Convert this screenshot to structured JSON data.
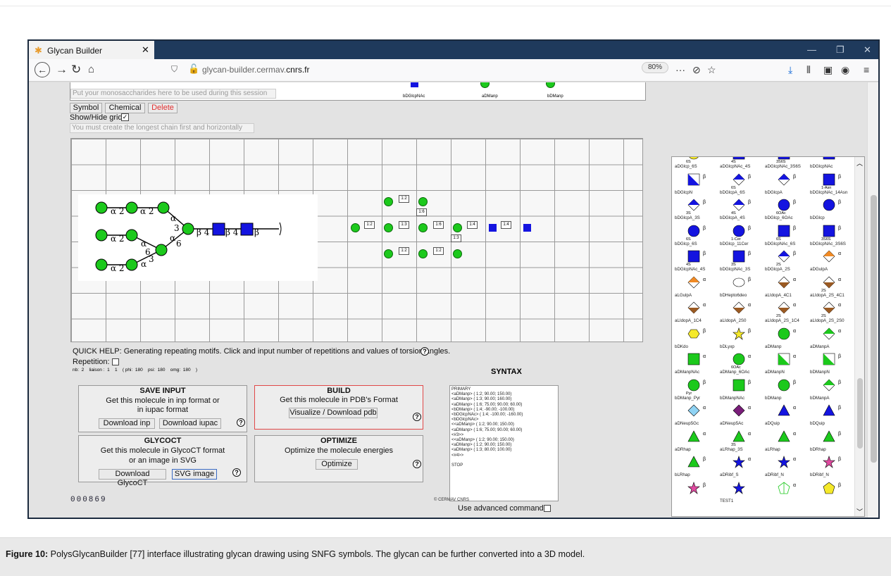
{
  "browser": {
    "tab_title": "Glycan Builder",
    "url_prefix": "glycan-builder.cermav.",
    "url_domain": "cnrs.fr",
    "zoom": "80%"
  },
  "session": {
    "placeholder": "Put your monosaccharides here to be used during this session",
    "items": [
      "bDGlcpNAc",
      "aDManp",
      "bDManp"
    ]
  },
  "toolbar": {
    "symbol": "Symbol",
    "chemical": "Chemical",
    "delete": "Delete",
    "grid_toggle": "Show/Hide grid",
    "chain_hint": "You must create the longest chain first and horizontally"
  },
  "canvas": {
    "link_labels": [
      "1:2",
      "1:6",
      "1:2",
      "1:3",
      "1:6",
      "1:4",
      "1:3",
      "1:4",
      "1:2",
      "1:2"
    ]
  },
  "quick_help": {
    "text": "QUICK HELP: Generating repeating motifs. Click and input number of repetitions and values of torsion angles.",
    "repetition": "Repetition:",
    "params": "nb:  2    liaison :  1    1    ( phi:  180    psi:  180    omg:  180    )"
  },
  "panels": {
    "save": {
      "title": "SAVE INPUT",
      "line1": "Get this molecule in inp format or",
      "line2": "in iupac format",
      "btn1": "Download inp",
      "btn2": "Download iupac"
    },
    "build": {
      "title": "BUILD",
      "line1": "Get this molecule in PDB's Format",
      "btn": "Visualize / Download pdb"
    },
    "glycoct": {
      "title": "GLYCOCT",
      "line1": "Get this molecule in GlycoCT format",
      "line2": "or an image in SVG",
      "btn1": "Download GlycoCT",
      "btn2": "SVG image"
    },
    "optimize": {
      "title": "OPTIMIZE",
      "line1": "Optimize the molecule energies",
      "btn": "Optimize"
    }
  },
  "syntax": {
    "title": "SYNTAX",
    "lines": [
      "PRIMARY",
      "<aDManp> ( 1:2; 90.00; 150.00)",
      "<aDManp> ( 1:3; 90.00; 160.00)",
      "<aDManp> ( 1:6; 75.00; 90.00; 60.00)",
      "<bDManp> ( 1:4; -90.00; -100.00)",
      "<bDGlcpNAc> ( 1:4; -100.00; -160.00)",
      "<bDGlcpNAc>",
      "<<aDManp> ( 1:2; 90.00; 150.00)",
      "<aDManp> ( 1:6; 75.00; 90.00; 60.00)",
      "<#3>>",
      "<<aDManp> ( 1:2; 90.00; 150.00)",
      "<aDManp> ( 1:2; 90.00; 150.00)",
      "<aDManp> ( 1:3; 80.00; 100.00)",
      "<#4>>",
      "",
      "STOP"
    ],
    "advanced": "Use advanced commands"
  },
  "footer": {
    "counter": "000869",
    "copyright": "© CERMAV CNRS"
  },
  "palette": [
    {
      "name": "aDGlcp_6S",
      "shape": "circle",
      "color": "#f5e92a",
      "anom": "",
      "sub": "6S"
    },
    {
      "name": "aDGlcpNAc_4S",
      "shape": "square",
      "color": "#1414e0",
      "anom": "",
      "sub": "4S"
    },
    {
      "name": "aDGlcpNAc_3S6S",
      "shape": "square",
      "color": "#1414e0",
      "anom": "",
      "sub": "3S6S"
    },
    {
      "name": "bDGlcpNAc",
      "shape": "square",
      "color": "#1414e0",
      "anom": "",
      "sub": ""
    },
    {
      "name": "bDGlcpN",
      "shape": "cross-sq",
      "color": "#1414e0",
      "anom": "β",
      "sub": ""
    },
    {
      "name": "bDGlcpA_6S",
      "shape": "diamond-top",
      "color": "#1414e0",
      "anom": "β",
      "sub": "6S"
    },
    {
      "name": "bDGlcpA",
      "shape": "diamond-top",
      "color": "#1414e0",
      "anom": "β",
      "sub": ""
    },
    {
      "name": "bDGlcpNAc_14Asn",
      "shape": "square",
      "color": "#1414e0",
      "anom": "β",
      "sub": "1-Asn"
    },
    {
      "name": "bDGlcpA_3S",
      "shape": "diamond-top",
      "color": "#1414e0",
      "anom": "β",
      "sub": "3S"
    },
    {
      "name": "bDGlcpA_4S",
      "shape": "diamond-top",
      "color": "#1414e0",
      "anom": "β",
      "sub": "4S"
    },
    {
      "name": "bDGlcp_6OAc",
      "shape": "circle",
      "color": "#1414e0",
      "anom": "β",
      "sub": "6OAc"
    },
    {
      "name": "bDGlcp",
      "shape": "circle",
      "color": "#1414e0",
      "anom": "β",
      "sub": ""
    },
    {
      "name": "bDGlcp_6S",
      "shape": "circle",
      "color": "#1414e0",
      "anom": "β",
      "sub": "6S"
    },
    {
      "name": "bDGlcp_11Cer",
      "shape": "circle",
      "color": "#1414e0",
      "anom": "β",
      "sub": "1-Cer"
    },
    {
      "name": "bDGlcpNAc_6S",
      "shape": "square",
      "color": "#1414e0",
      "anom": "β",
      "sub": "6S"
    },
    {
      "name": "bDGlcpNAc_3S6S",
      "shape": "square",
      "color": "#1414e0",
      "anom": "β",
      "sub": "3S6S"
    },
    {
      "name": "bDGlcpNAc_4S",
      "shape": "square",
      "color": "#1414e0",
      "anom": "β",
      "sub": "4S"
    },
    {
      "name": "bDGlcpNAc_3S",
      "shape": "square",
      "color": "#1414e0",
      "anom": "β",
      "sub": "3S"
    },
    {
      "name": "bDGlcpA_2S",
      "shape": "diamond-top",
      "color": "#1414e0",
      "anom": "β",
      "sub": "2S"
    },
    {
      "name": "aDGulpA",
      "shape": "diamond-top",
      "color": "#f08a24",
      "anom": "α",
      "sub": ""
    },
    {
      "name": "aLGulpA",
      "shape": "diamond-top",
      "color": "#f08a24",
      "anom": "α",
      "sub": ""
    },
    {
      "name": "bDHepto6deo",
      "shape": "oval",
      "color": "#ffffff",
      "anom": "β",
      "sub": ""
    },
    {
      "name": "aLIdopA_4C1",
      "shape": "diamond-bot",
      "color": "#9b5a22",
      "anom": "α",
      "sub": ""
    },
    {
      "name": "aLIdopA_2S_4C1",
      "shape": "diamond-bot",
      "color": "#9b5a22",
      "anom": "α",
      "sub": "2S"
    },
    {
      "name": "aLIdopA_1C4",
      "shape": "diamond-bot",
      "color": "#9b5a22",
      "anom": "α",
      "sub": ""
    },
    {
      "name": "aLIdopA_2S0",
      "shape": "diamond-bot",
      "color": "#9b5a22",
      "anom": "α",
      "sub": ""
    },
    {
      "name": "aLIdopA_2S_1C4",
      "shape": "diamond-bot",
      "color": "#9b5a22",
      "anom": "α",
      "sub": "2S"
    },
    {
      "name": "aLIdopA_2S_2S0",
      "shape": "diamond-bot",
      "color": "#9b5a22",
      "anom": "α",
      "sub": "2S"
    },
    {
      "name": "bDKdo",
      "shape": "hexagon",
      "color": "#f5e92a",
      "anom": "β",
      "sub": ""
    },
    {
      "name": "bDLyxp",
      "shape": "star",
      "color": "#f5e92a",
      "anom": "β",
      "sub": ""
    },
    {
      "name": "aDManp",
      "shape": "circle",
      "color": "#1cc91c",
      "anom": "α",
      "sub": ""
    },
    {
      "name": "aDManpA",
      "shape": "diamond-top",
      "color": "#1cc91c",
      "anom": "α",
      "sub": ""
    },
    {
      "name": "aDManpNAc",
      "shape": "square",
      "color": "#1cc91c",
      "anom": "α",
      "sub": ""
    },
    {
      "name": "aDManp_6OAc",
      "shape": "circle",
      "color": "#1cc91c",
      "anom": "α",
      "sub": "6OAc"
    },
    {
      "name": "aDManpN",
      "shape": "cross-sq",
      "color": "#1cc91c",
      "anom": "α",
      "sub": ""
    },
    {
      "name": "bDManpN",
      "shape": "cross-sq",
      "color": "#1cc91c",
      "anom": "β",
      "sub": ""
    },
    {
      "name": "bDManp_Pyr",
      "shape": "circle",
      "color": "#1cc91c",
      "anom": "β",
      "sub": "Pyr"
    },
    {
      "name": "bDManpNAc",
      "shape": "square",
      "color": "#1cc91c",
      "anom": "β",
      "sub": ""
    },
    {
      "name": "bDManp",
      "shape": "circle",
      "color": "#1cc91c",
      "anom": "β",
      "sub": ""
    },
    {
      "name": "bDManpA",
      "shape": "diamond-top",
      "color": "#1cc91c",
      "anom": "β",
      "sub": ""
    },
    {
      "name": "aDNeup5Gc",
      "shape": "diamond",
      "color": "#8fd3f4",
      "anom": "α",
      "sub": ""
    },
    {
      "name": "aDNeup5Ac",
      "shape": "diamond",
      "color": "#7a1d7a",
      "anom": "α",
      "sub": ""
    },
    {
      "name": "aDQuip",
      "shape": "triangle",
      "color": "#1414e0",
      "anom": "α",
      "sub": ""
    },
    {
      "name": "bDQuip",
      "shape": "triangle",
      "color": "#1414e0",
      "anom": "β",
      "sub": ""
    },
    {
      "name": "aDRhap",
      "shape": "triangle",
      "color": "#1cc91c",
      "anom": "α",
      "sub": ""
    },
    {
      "name": "aLRhap_3S",
      "shape": "triangle",
      "color": "#1cc91c",
      "anom": "α",
      "sub": "3S"
    },
    {
      "name": "aLRhap",
      "shape": "triangle",
      "color": "#1cc91c",
      "anom": "α",
      "sub": ""
    },
    {
      "name": "bDRhap",
      "shape": "triangle",
      "color": "#1cc91c",
      "anom": "β",
      "sub": ""
    },
    {
      "name": "bLRhap",
      "shape": "triangle",
      "color": "#1cc91c",
      "anom": "β",
      "sub": ""
    },
    {
      "name": "aDRibf_S",
      "shape": "star",
      "color": "#1414e0",
      "anom": "α",
      "sub": ""
    },
    {
      "name": "aDRibf_N",
      "shape": "star",
      "color": "#1414e0",
      "anom": "α",
      "sub": ""
    },
    {
      "name": "bDRibf_N",
      "shape": "star",
      "color": "#e04aa0",
      "anom": "β",
      "sub": ""
    },
    {
      "name": "",
      "shape": "star",
      "color": "#e04aa0",
      "anom": "β",
      "sub": ""
    },
    {
      "name": "TEST1",
      "shape": "star",
      "color": "#1414e0",
      "anom": "",
      "sub": ""
    },
    {
      "name": "",
      "shape": "pentagon-open",
      "color": "#ffffff",
      "anom": "α",
      "sub": ""
    },
    {
      "name": "",
      "shape": "pentagon",
      "color": "#f5e92a",
      "anom": "β",
      "sub": ""
    }
  ],
  "caption": {
    "label": "Figure 10:",
    "text": " PolysGlycanBuilder [77] interface illustrating glycan drawing using SNFG symbols. The glycan can be further converted into a 3D model."
  }
}
